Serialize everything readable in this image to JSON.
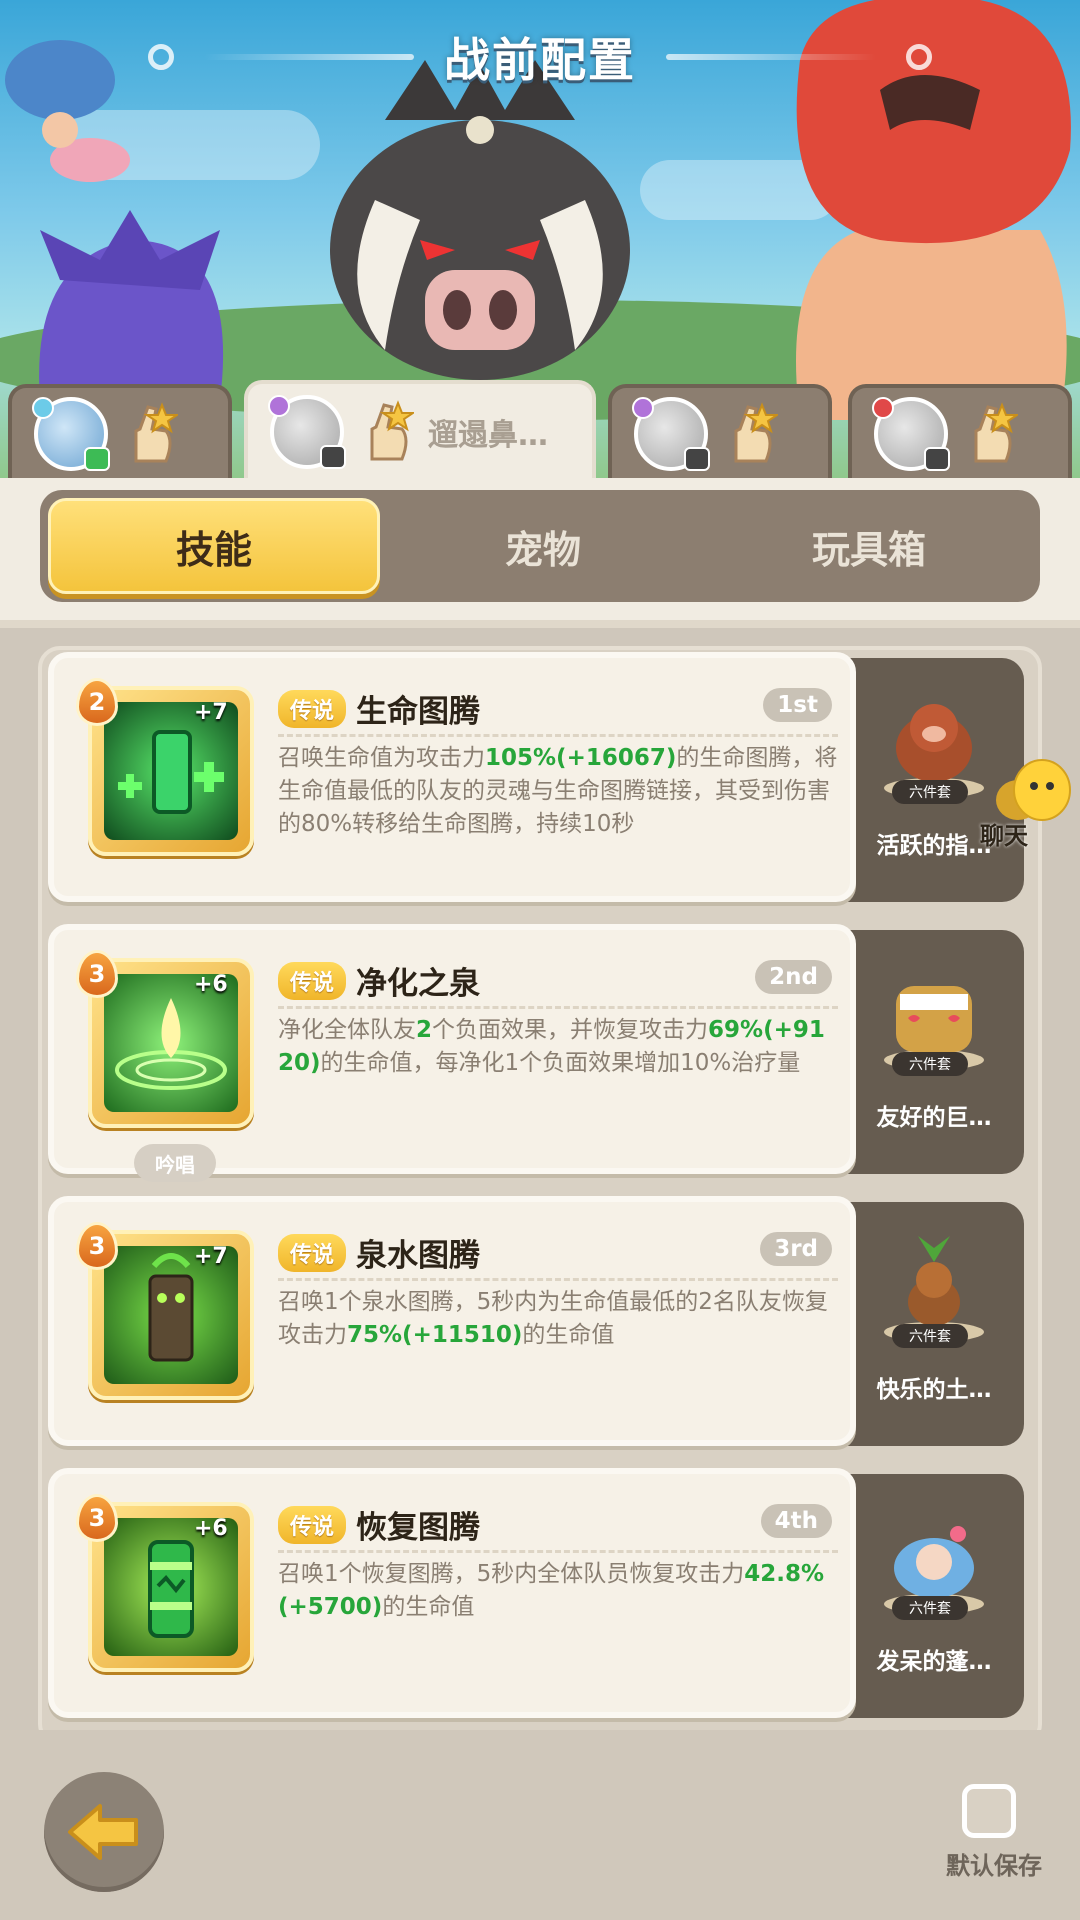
{
  "header": {
    "title": "战前配置"
  },
  "player_tabs": [
    {
      "name": "",
      "active": false
    },
    {
      "name": "遛遢鼻…",
      "active": true
    },
    {
      "name": "",
      "active": false
    },
    {
      "name": "",
      "active": false
    }
  ],
  "category_tabs": [
    "技能",
    "宠物",
    "玩具箱"
  ],
  "active_category": "技能",
  "skills": [
    {
      "level": "2",
      "plus": "+7",
      "rarity": "传说",
      "name": "生命图腾",
      "rank": "1st",
      "desc_parts": [
        "召唤生命值为攻击力",
        "105%(+16067)",
        "的生命图腾，将生命值最低的队友的灵魂与生命图腾链接，其受到伤害的80%转移给生命图腾，持续10秒"
      ],
      "pet_name": "活跃的指…",
      "pet_tag": "六件套",
      "cast_tag": ""
    },
    {
      "level": "3",
      "plus": "+6",
      "rarity": "传说",
      "name": "净化之泉",
      "rank": "2nd",
      "desc_parts": [
        "净化全体队友",
        "2",
        "个负面效果，并恢复攻击力",
        "69%(+9120)",
        "的生命值，每净化1个负面效果增加10%治疗量"
      ],
      "pet_name": "友好的巨…",
      "pet_tag": "六件套",
      "cast_tag": "吟唱"
    },
    {
      "level": "3",
      "plus": "+7",
      "rarity": "传说",
      "name": "泉水图腾",
      "rank": "3rd",
      "desc_parts": [
        "召唤1个泉水图腾，5秒内为生命值最低的2名队友恢复攻击力",
        "75%(+11510)",
        "的生命值"
      ],
      "pet_name": "快乐的土…",
      "pet_tag": "六件套",
      "cast_tag": ""
    },
    {
      "level": "3",
      "plus": "+6",
      "rarity": "传说",
      "name": "恢复图腾",
      "rank": "4th",
      "desc_parts": [
        "召唤1个恢复图腾，5秒内全体队员恢复攻击力",
        "42.8%(+5700)",
        "的生命值"
      ],
      "pet_name": "发呆的蓬…",
      "pet_tag": "六件套",
      "cast_tag": ""
    }
  ],
  "chat": {
    "label": "聊天"
  },
  "footer": {
    "save_label": "默认保存",
    "default_save_checked": false
  },
  "colors": {
    "highlight": "#27a63a",
    "accent": "#f4c43c"
  }
}
